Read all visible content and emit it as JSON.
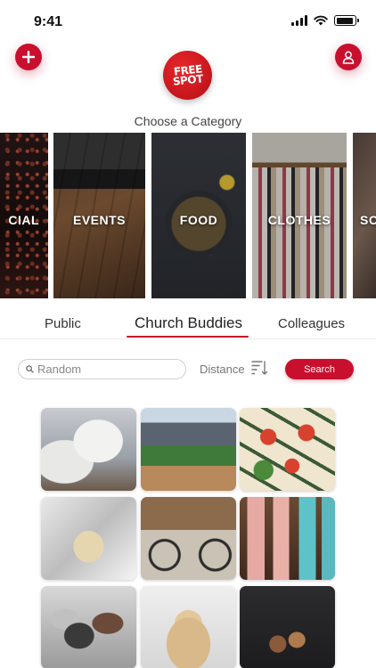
{
  "status_bar": {
    "time": "9:41",
    "battery_level": 0.9
  },
  "header": {
    "add_icon": "plus-icon",
    "profile_icon": "user-icon",
    "logo_line1": "FREE",
    "logo_line2": "SPOT",
    "brand_color": "#c8102e"
  },
  "categories": {
    "heading": "Choose a Category",
    "items": [
      {
        "label": "CIAL"
      },
      {
        "label": "EVENTS"
      },
      {
        "label": "FOOD"
      },
      {
        "label": "CLOTHES"
      },
      {
        "label": "SO"
      }
    ]
  },
  "tabs": {
    "items": [
      {
        "label": "Public"
      },
      {
        "label": "Church Buddies"
      },
      {
        "label": "Colleagues"
      }
    ],
    "active": "Church Buddies"
  },
  "search": {
    "placeholder": "Random",
    "distance_label": "Distance",
    "button_label": "Search",
    "search_icon": "search-icon",
    "sort_icon": "sort-descending-icon"
  },
  "items": [
    {
      "subject": "sneakers"
    },
    {
      "subject": "baseball"
    },
    {
      "subject": "appetizers"
    },
    {
      "subject": "perfume"
    },
    {
      "subject": "bicycle"
    },
    {
      "subject": "toiletries"
    },
    {
      "subject": "shoes"
    },
    {
      "subject": "hats"
    },
    {
      "subject": "candles"
    }
  ]
}
